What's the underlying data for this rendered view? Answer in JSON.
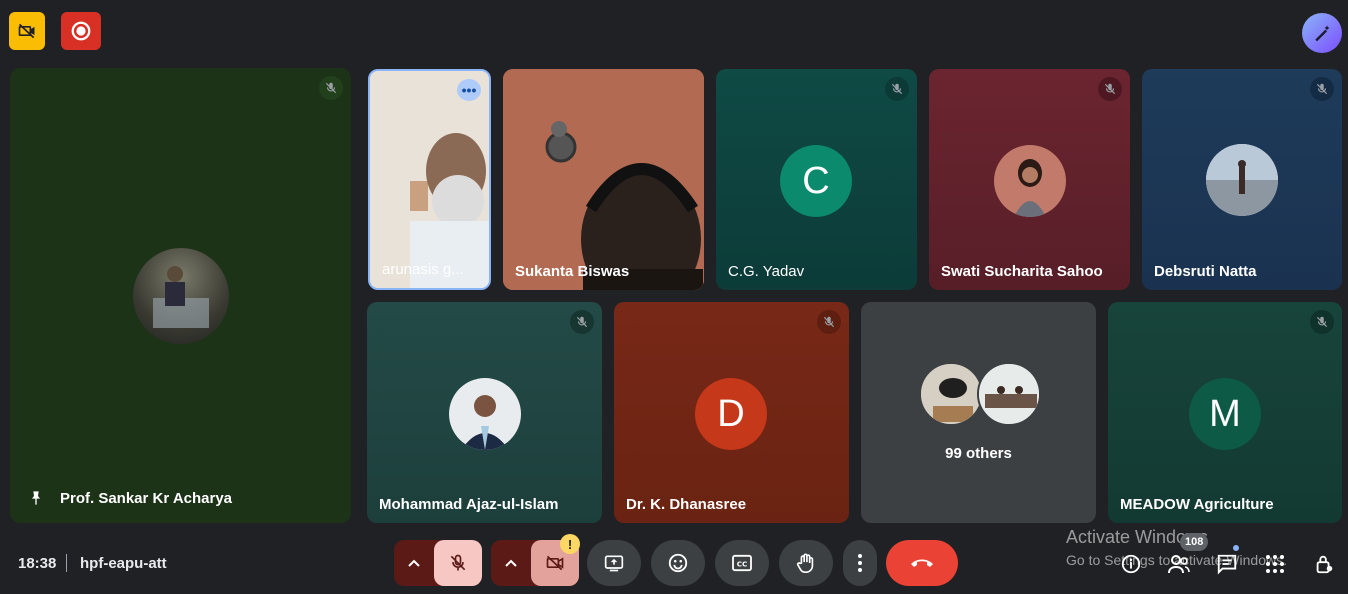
{
  "topbar": {
    "no_video_icon": "camera-off-icon",
    "record_icon": "record-icon",
    "effects_icon": "magic-pen-icon"
  },
  "tiles": {
    "pinned": {
      "name": "Prof. Sankar Kr Acharya",
      "color": "#1e3a1a"
    },
    "t1": {
      "name": "arunasis g..."
    },
    "t2": {
      "name": "Sukanta Biswas"
    },
    "t3": {
      "name": "C.G. Yadav",
      "initial": "C",
      "color": "#0b8a6e"
    },
    "t4": {
      "name": "Swati Sucharita Sahoo"
    },
    "t5": {
      "name": "Debsruti Natta"
    },
    "t6": {
      "name": "Mohammad Ajaz-ul-Islam"
    },
    "t7": {
      "name": "Dr. K. Dhanasree",
      "initial": "D",
      "color": "#c5381a"
    },
    "t8": {
      "name": "99 others"
    },
    "t9": {
      "name": "MEADOW Agriculture",
      "initial": "M",
      "color": "#0d5a46"
    }
  },
  "bottombar": {
    "time": "18:38",
    "meeting_code": "hpf-eapu-att",
    "warn_badge": "!",
    "participants_count": "108"
  },
  "watermark": {
    "line1": "Activate Windows",
    "line2": "Go to Settings to activate Windows."
  }
}
